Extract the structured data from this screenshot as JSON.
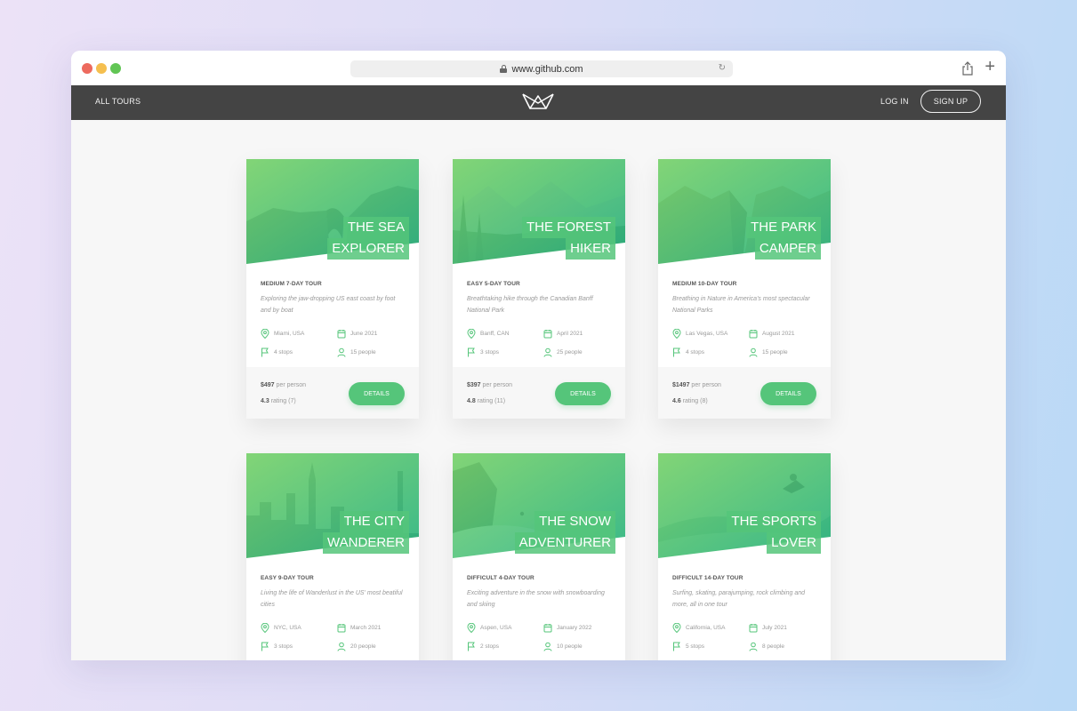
{
  "browser": {
    "url": "www.github.com"
  },
  "nav": {
    "all_tours": "ALL TOURS",
    "login": "LOG IN",
    "signup": "SIGN UP"
  },
  "colors": {
    "accent": "#55c57a",
    "nav_bg": "#444444"
  },
  "cards": [
    {
      "title_line1": "THE SEA",
      "title_line2": "EXPLORER",
      "subtitle": "MEDIUM 7-DAY TOUR",
      "summary": "Exploring the jaw-dropping US east coast by foot and by boat",
      "location": "Miami, USA",
      "date": "June 2021",
      "stops": "4 stops",
      "people": "15 people",
      "price": "$497",
      "price_label": "per person",
      "rating": "4.3",
      "rating_label": "rating (7)",
      "button": "DETAILS"
    },
    {
      "title_line1": "THE FOREST",
      "title_line2": "HIKER",
      "subtitle": "EASY 5-DAY TOUR",
      "summary": "Breathtaking hike through the Canadian Banff National Park",
      "location": "Banff, CAN",
      "date": "April 2021",
      "stops": "3 stops",
      "people": "25 people",
      "price": "$397",
      "price_label": "per person",
      "rating": "4.8",
      "rating_label": "rating (11)",
      "button": "DETAILS"
    },
    {
      "title_line1": "THE PARK",
      "title_line2": "CAMPER",
      "subtitle": "MEDIUM 10-DAY TOUR",
      "summary": "Breathing in Nature in America's most spectacular National Parks",
      "location": "Las Vegas, USA",
      "date": "August 2021",
      "stops": "4 stops",
      "people": "15 people",
      "price": "$1497",
      "price_label": "per person",
      "rating": "4.6",
      "rating_label": "rating (8)",
      "button": "DETAILS"
    },
    {
      "title_line1": "THE CITY",
      "title_line2": "WANDERER",
      "subtitle": "EASY 9-DAY TOUR",
      "summary": "Living the life of Wanderlust in the US' most beatiful cities",
      "location": "NYC, USA",
      "date": "March 2021",
      "stops": "3 stops",
      "people": "20 people"
    },
    {
      "title_line1": "THE SNOW",
      "title_line2": "ADVENTURER",
      "subtitle": "DIFFICULT 4-DAY TOUR",
      "summary": "Exciting adventure in the snow with snowboarding and skiing",
      "location": "Aspen, USA",
      "date": "January 2022",
      "stops": "2 stops",
      "people": "10 people"
    },
    {
      "title_line1": "THE SPORTS",
      "title_line2": "LOVER",
      "subtitle": "DIFFICULT 14-DAY TOUR",
      "summary": "Surfing, skating, parajumping, rock climbing and more, all in one tour",
      "location": "California, USA",
      "date": "July 2021",
      "stops": "5 stops",
      "people": "8 people"
    }
  ]
}
